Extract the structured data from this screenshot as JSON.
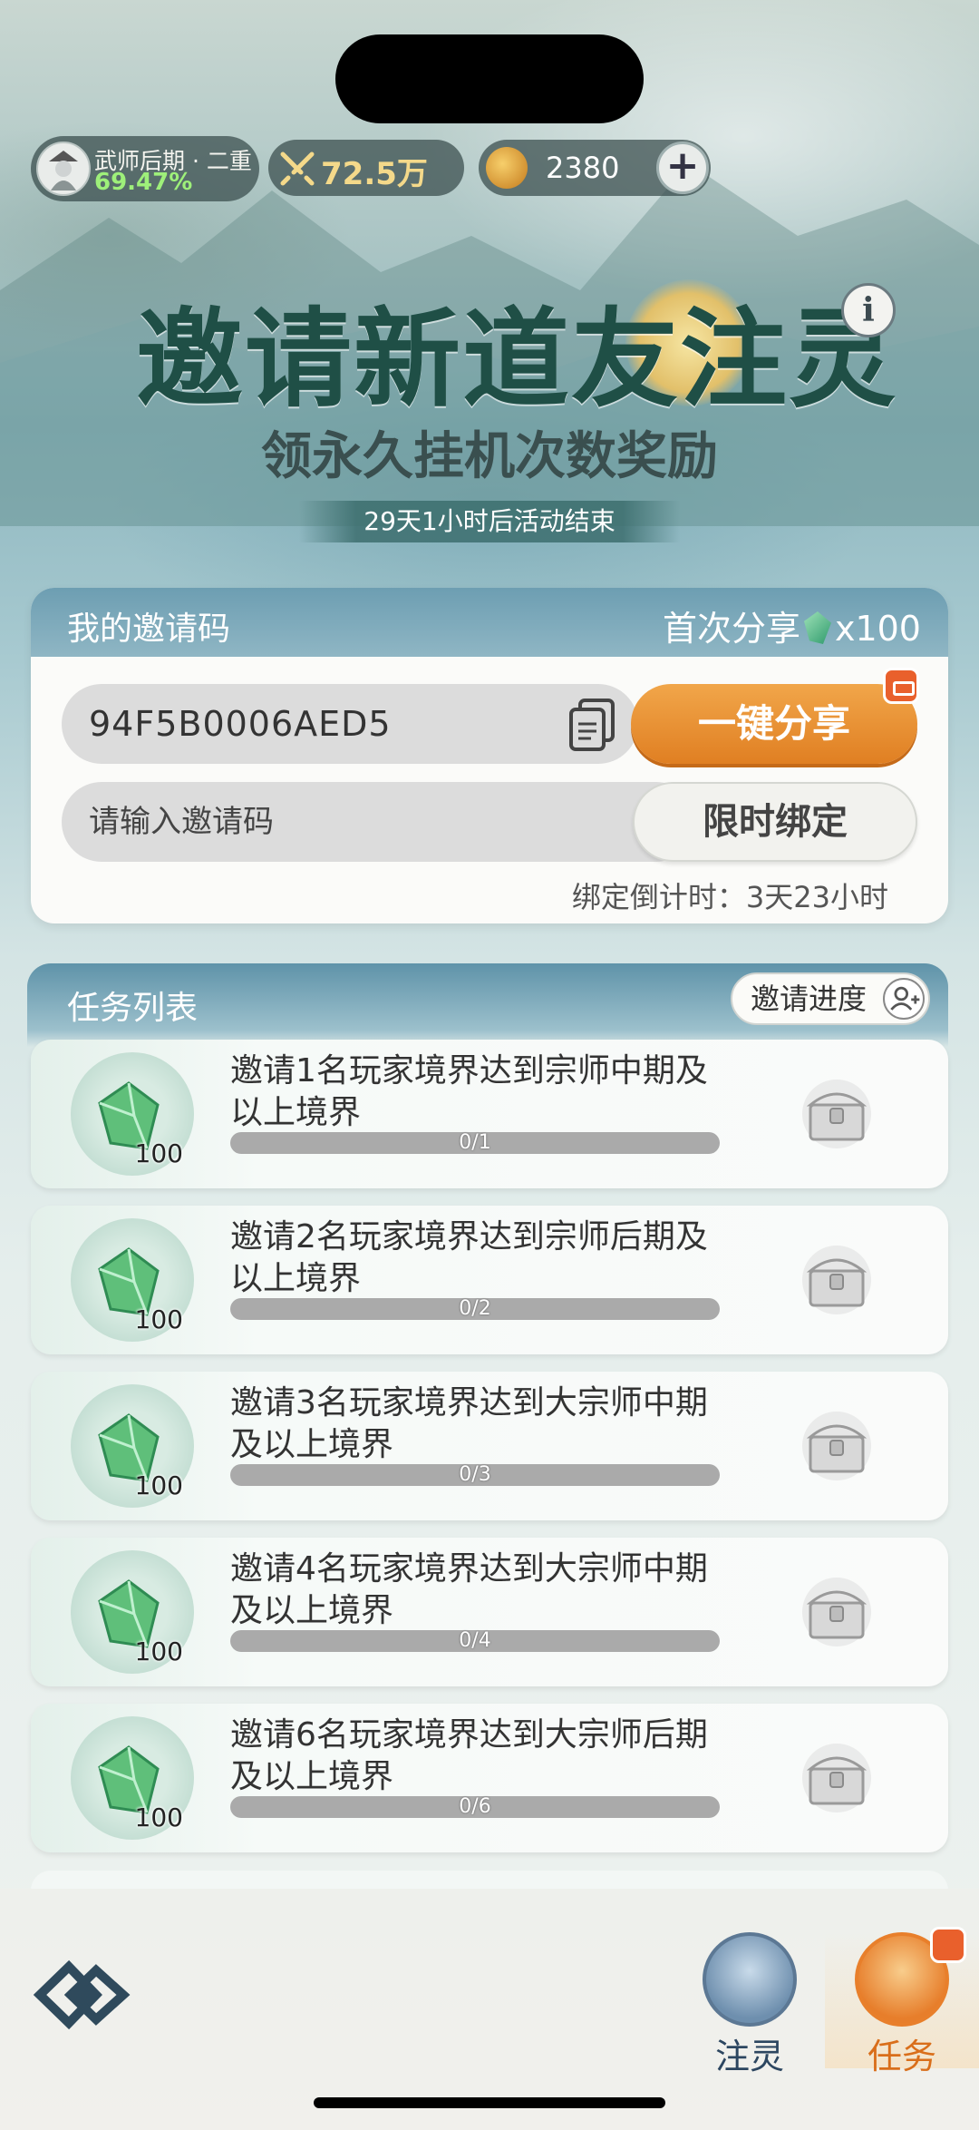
{
  "status": {
    "realm_name": "武师后期 · 二重",
    "realm_progress": "69.47%",
    "power": "72.5万",
    "coins": "2380",
    "add_label": "+"
  },
  "banner": {
    "title": "邀请新道友注灵",
    "subtitle": "领永久挂机次数奖励",
    "end_time": "29天1小时后活动结束",
    "info_label": "i"
  },
  "invite": {
    "header_title": "我的邀请码",
    "first_share_label": "首次分享",
    "first_share_reward": "x100",
    "code": "94F5B0006AED5",
    "share_button": "一键分享",
    "input_placeholder": "请输入邀请码",
    "bind_button": "限时绑定",
    "countdown": "绑定倒计时：3天23小时"
  },
  "tasks": {
    "header_title": "任务列表",
    "progress_button": "邀请进度",
    "items": [
      {
        "text": "邀请1名玩家境界达到宗师中期及以上境界",
        "reward": "100",
        "progress": "0/1",
        "fraction": 0
      },
      {
        "text": "邀请2名玩家境界达到宗师后期及以上境界",
        "reward": "100",
        "progress": "0/2",
        "fraction": 0
      },
      {
        "text": "邀请3名玩家境界达到大宗师中期及以上境界",
        "reward": "100",
        "progress": "0/3",
        "fraction": 0
      },
      {
        "text": "邀请4名玩家境界达到大宗师中期及以上境界",
        "reward": "100",
        "progress": "0/4",
        "fraction": 0
      },
      {
        "text": "邀请6名玩家境界达到大宗师后期及以上境界",
        "reward": "100",
        "progress": "0/6",
        "fraction": 0
      }
    ]
  },
  "nav": {
    "items": [
      {
        "label": "注灵",
        "icon": "spirit-icon"
      },
      {
        "label": "任务",
        "icon": "task-gift-icon"
      }
    ]
  },
  "colors": {
    "accent_orange": "#e07f22",
    "title_green": "#1f4f46",
    "progress_green": "#9ef07a"
  }
}
